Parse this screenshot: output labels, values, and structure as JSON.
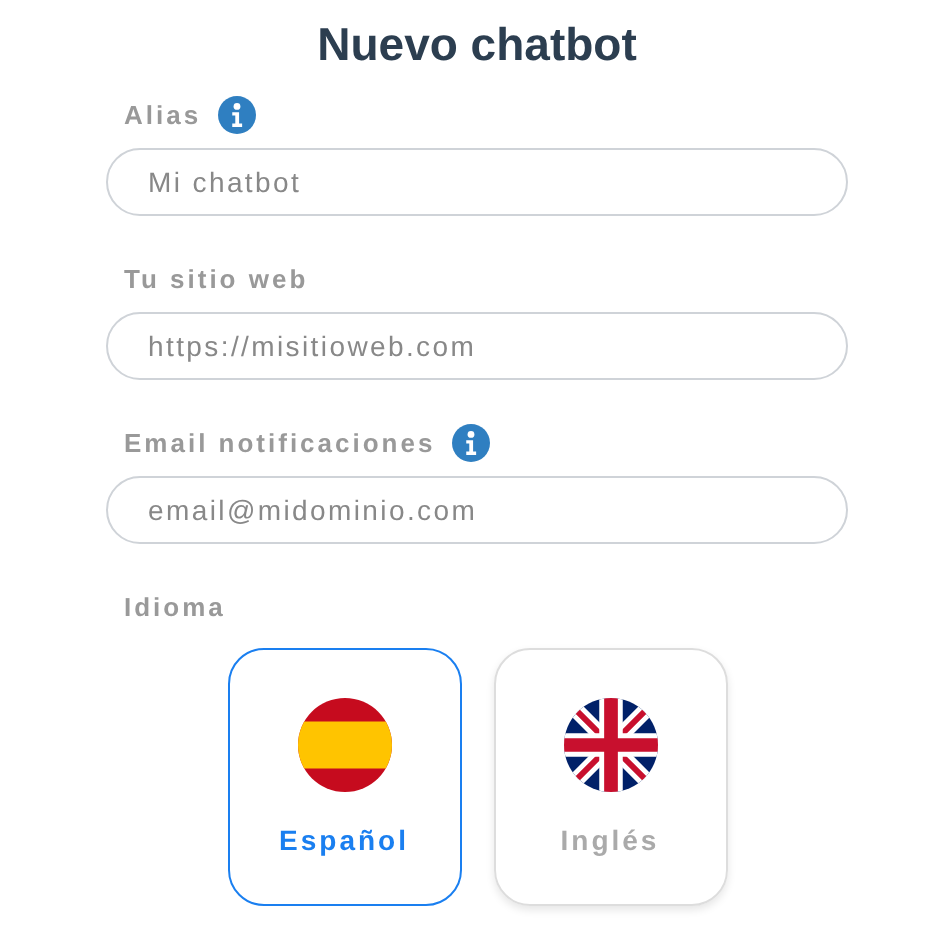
{
  "title": "Nuevo chatbot",
  "fields": [
    {
      "label": "Alias",
      "info": true,
      "placeholder": "Mi chatbot"
    },
    {
      "label": "Tu sitio web",
      "info": false,
      "placeholder": "https://misitioweb.com"
    },
    {
      "label": "Email notificaciones",
      "info": true,
      "placeholder": "email@midominio.com"
    }
  ],
  "language": {
    "label": "Idioma",
    "options": [
      {
        "label": "Español",
        "kind": "spain",
        "selected": true
      },
      {
        "label": "Inglés",
        "kind": "uk",
        "selected": false
      }
    ]
  }
}
